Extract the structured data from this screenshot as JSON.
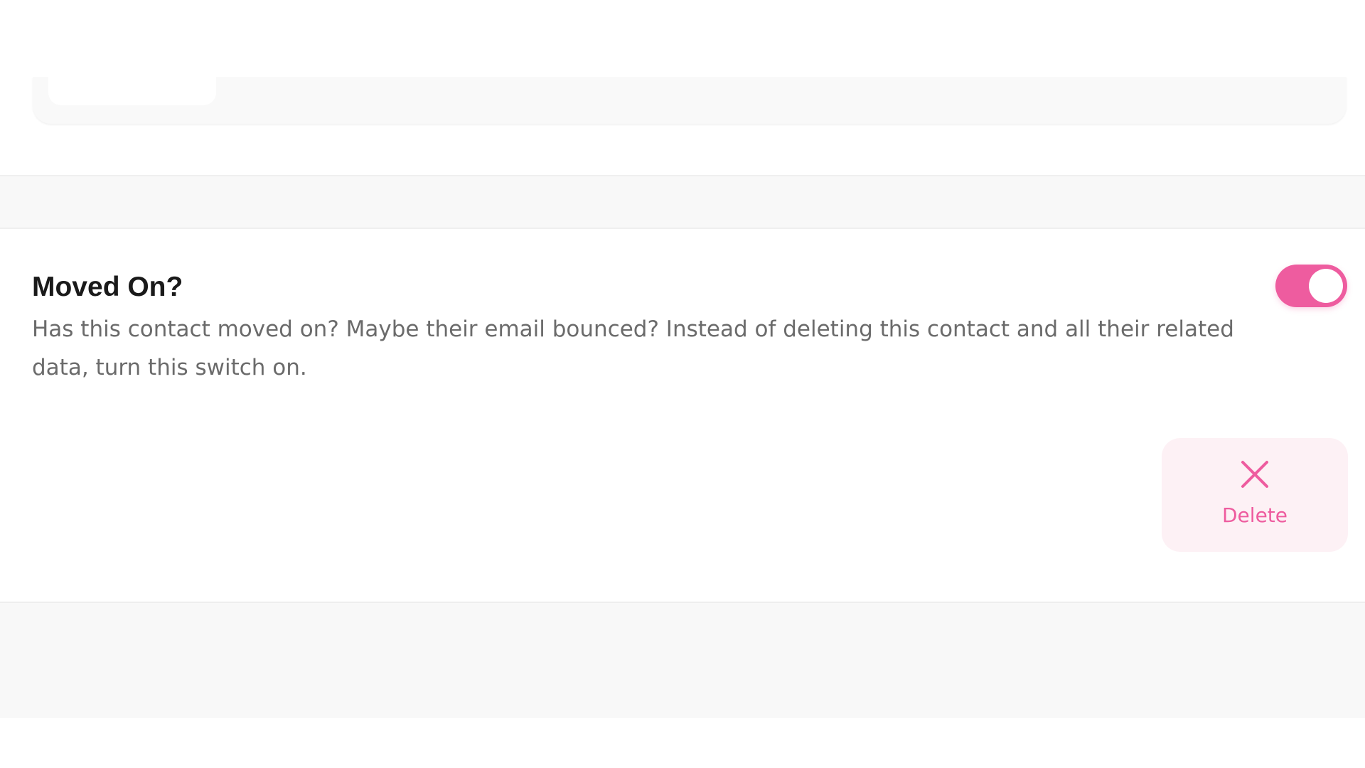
{
  "moved_on": {
    "title": "Moved On?",
    "description": "Has this contact moved on? Maybe their email bounced? Instead of deleting this contact and all their related data, turn this switch on.",
    "toggle_on": true
  },
  "actions": {
    "delete_label": "Delete"
  },
  "colors": {
    "accent": "#ee5c9f",
    "delete_bg": "#fdf1f5",
    "title_text": "#1a1a1a",
    "description_text": "#6b6b6b",
    "band": "#f8f8f8"
  },
  "icons": {
    "delete": "close-icon"
  }
}
